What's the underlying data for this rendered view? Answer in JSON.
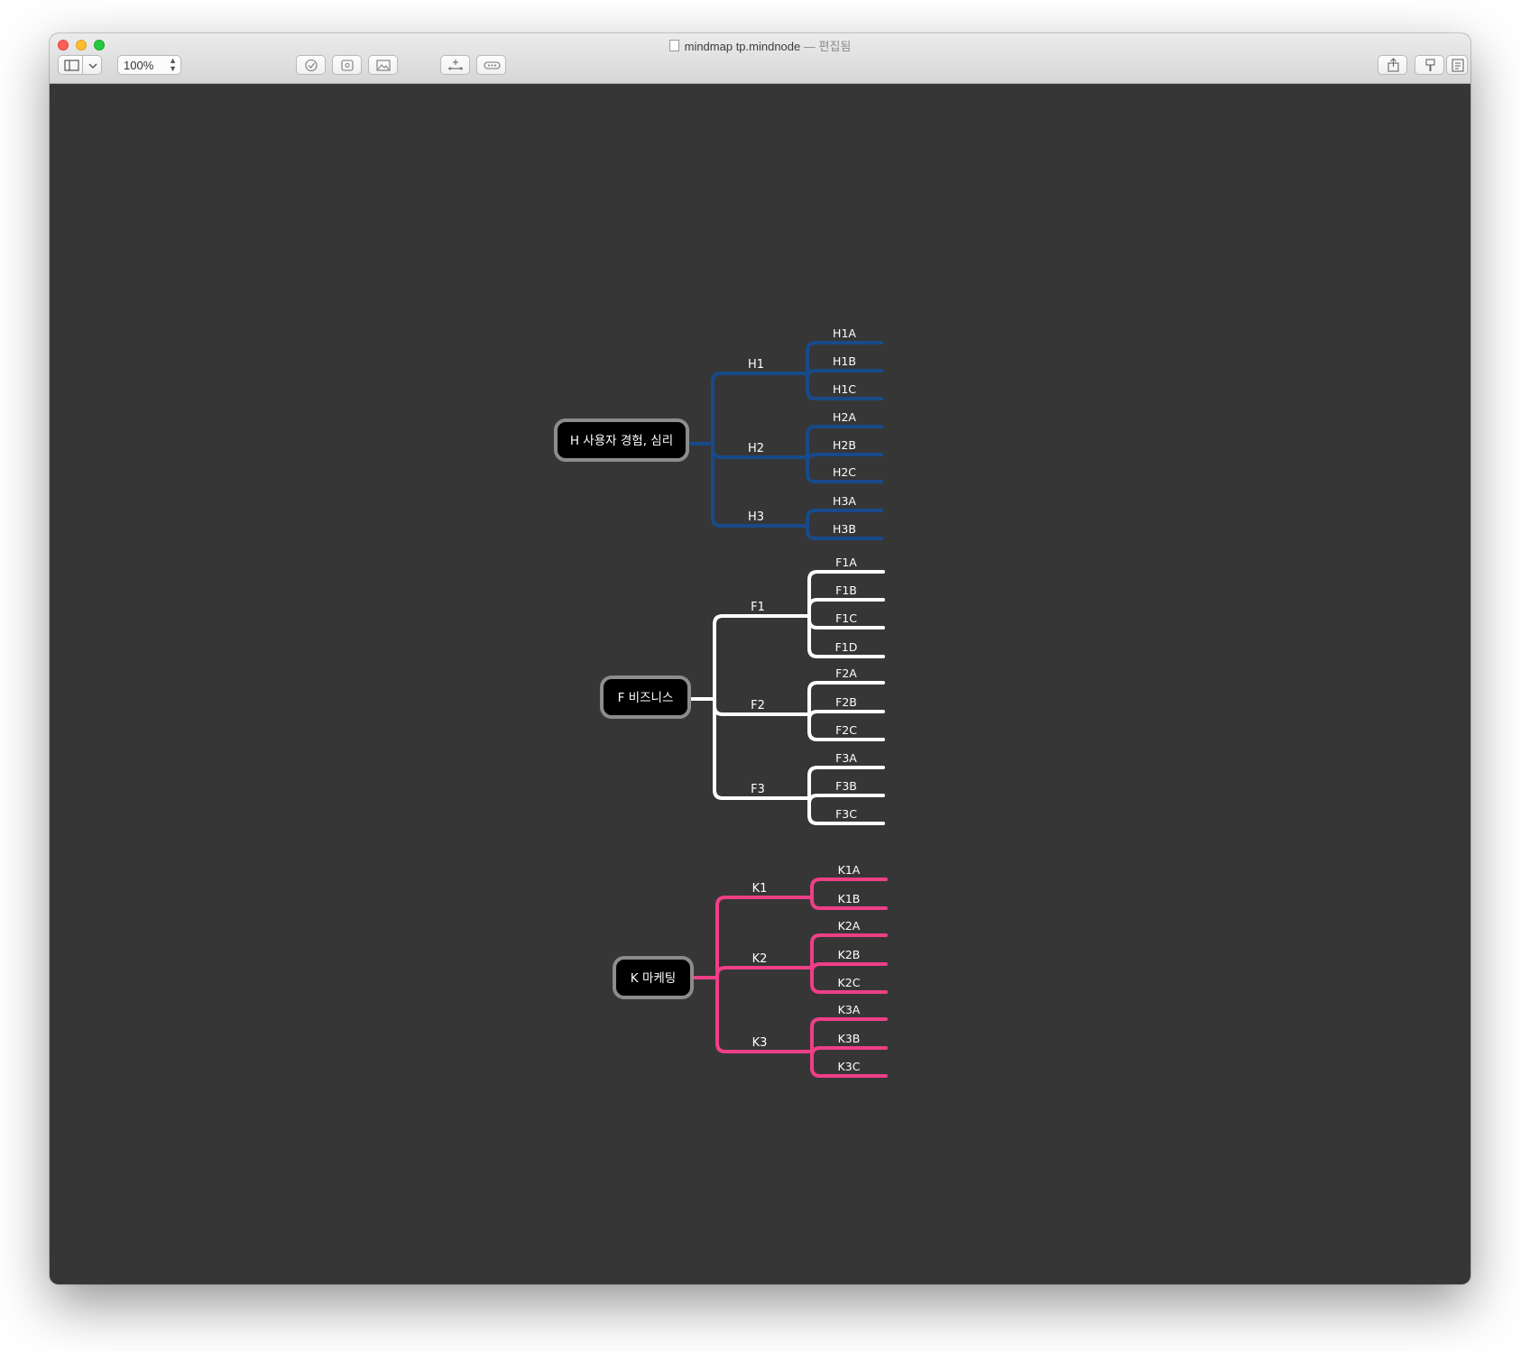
{
  "window": {
    "title": "mindmap tp.mindnode",
    "title_separator": "—",
    "status": "편집됨"
  },
  "toolbar": {
    "zoom_value": "100%",
    "buttons": [
      "sidebar-toggle",
      "sidebar-menu",
      "checkbox",
      "sticker",
      "image",
      "add-node",
      "connect",
      "share",
      "format",
      "notes"
    ]
  },
  "colors": {
    "canvas_bg": "#363636",
    "branch_h": "#184a8a",
    "branch_f": "#ffffff",
    "branch_k": "#ef3f86",
    "root_fill": "#000000",
    "root_border": "#8c8c8c"
  },
  "mindmap": {
    "roots": [
      {
        "label": "H 사용자 경험, 심리",
        "color": "#184a8a",
        "children": [
          {
            "label": "H1",
            "children": [
              "H1A",
              "H1B",
              "H1C"
            ]
          },
          {
            "label": "H2",
            "children": [
              "H2A",
              "H2B",
              "H2C"
            ]
          },
          {
            "label": "H3",
            "children": [
              "H3A",
              "H3B"
            ]
          }
        ]
      },
      {
        "label": "F 비즈니스",
        "color": "#ffffff",
        "children": [
          {
            "label": "F1",
            "children": [
              "F1A",
              "F1B",
              "F1C",
              "F1D"
            ]
          },
          {
            "label": "F2",
            "children": [
              "F2A",
              "F2B",
              "F2C"
            ]
          },
          {
            "label": "F3",
            "children": [
              "F3A",
              "F3B",
              "F3C"
            ]
          }
        ]
      },
      {
        "label": "K 마케팅",
        "color": "#ef3f86",
        "children": [
          {
            "label": "K1",
            "children": [
              "K1A",
              "K1B"
            ]
          },
          {
            "label": "K2",
            "children": [
              "K2A",
              "K2B",
              "K2C"
            ]
          },
          {
            "label": "K3",
            "children": [
              "K3A",
              "K3B",
              "K3C"
            ]
          }
        ]
      }
    ]
  }
}
